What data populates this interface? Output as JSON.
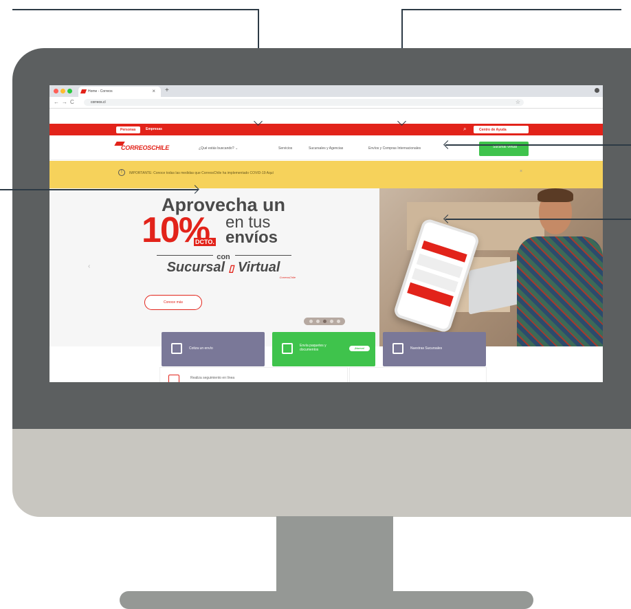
{
  "browser": {
    "tab_title": "Home - Correos",
    "tab_close": "×",
    "tab_new": "+",
    "back": "←",
    "forward": "→",
    "reload": "C",
    "url": "correos.cl",
    "star": "☆"
  },
  "topbar": {
    "personas": "Personas",
    "empresas": "Empresas",
    "search_icon": "⌕",
    "help_label": "Centro de Ayuda"
  },
  "navbar": {
    "logo": "CORREOSCHILE",
    "items": [
      "¿Qué estás buscando? ⌄",
      "Servicios",
      "Sucursales y Agencias",
      "Envíos y Compras Internacionales"
    ],
    "cta": "Sucursal Virtual"
  },
  "notice": {
    "icon": "!",
    "text": "IMPORTANTE: Conoce todas las medidas que CorreosChile ha implementado COVID-19 Aquí",
    "close": "×"
  },
  "hero": {
    "line1": "Aprovecha un",
    "big": "10%",
    "dcto": "DCTO.",
    "en_tus": "en tus",
    "envios": "envíos",
    "con": "con",
    "sucursal": "Sucursal",
    "virtual": "Virtual",
    "brand_tiny": "CorreosChile",
    "cta": "Conoce más",
    "prev": "‹"
  },
  "tiles": [
    {
      "label": "Cotiza un envío",
      "color": "#7a7898"
    },
    {
      "label": "Envía paquetes y documentos",
      "badge": "¡Nuevo!",
      "color": "#3fc34c"
    },
    {
      "label": "Nuestras Sucursales",
      "color": "#7a7898"
    }
  ],
  "card": {
    "label": "Realiza seguimiento en línea"
  }
}
